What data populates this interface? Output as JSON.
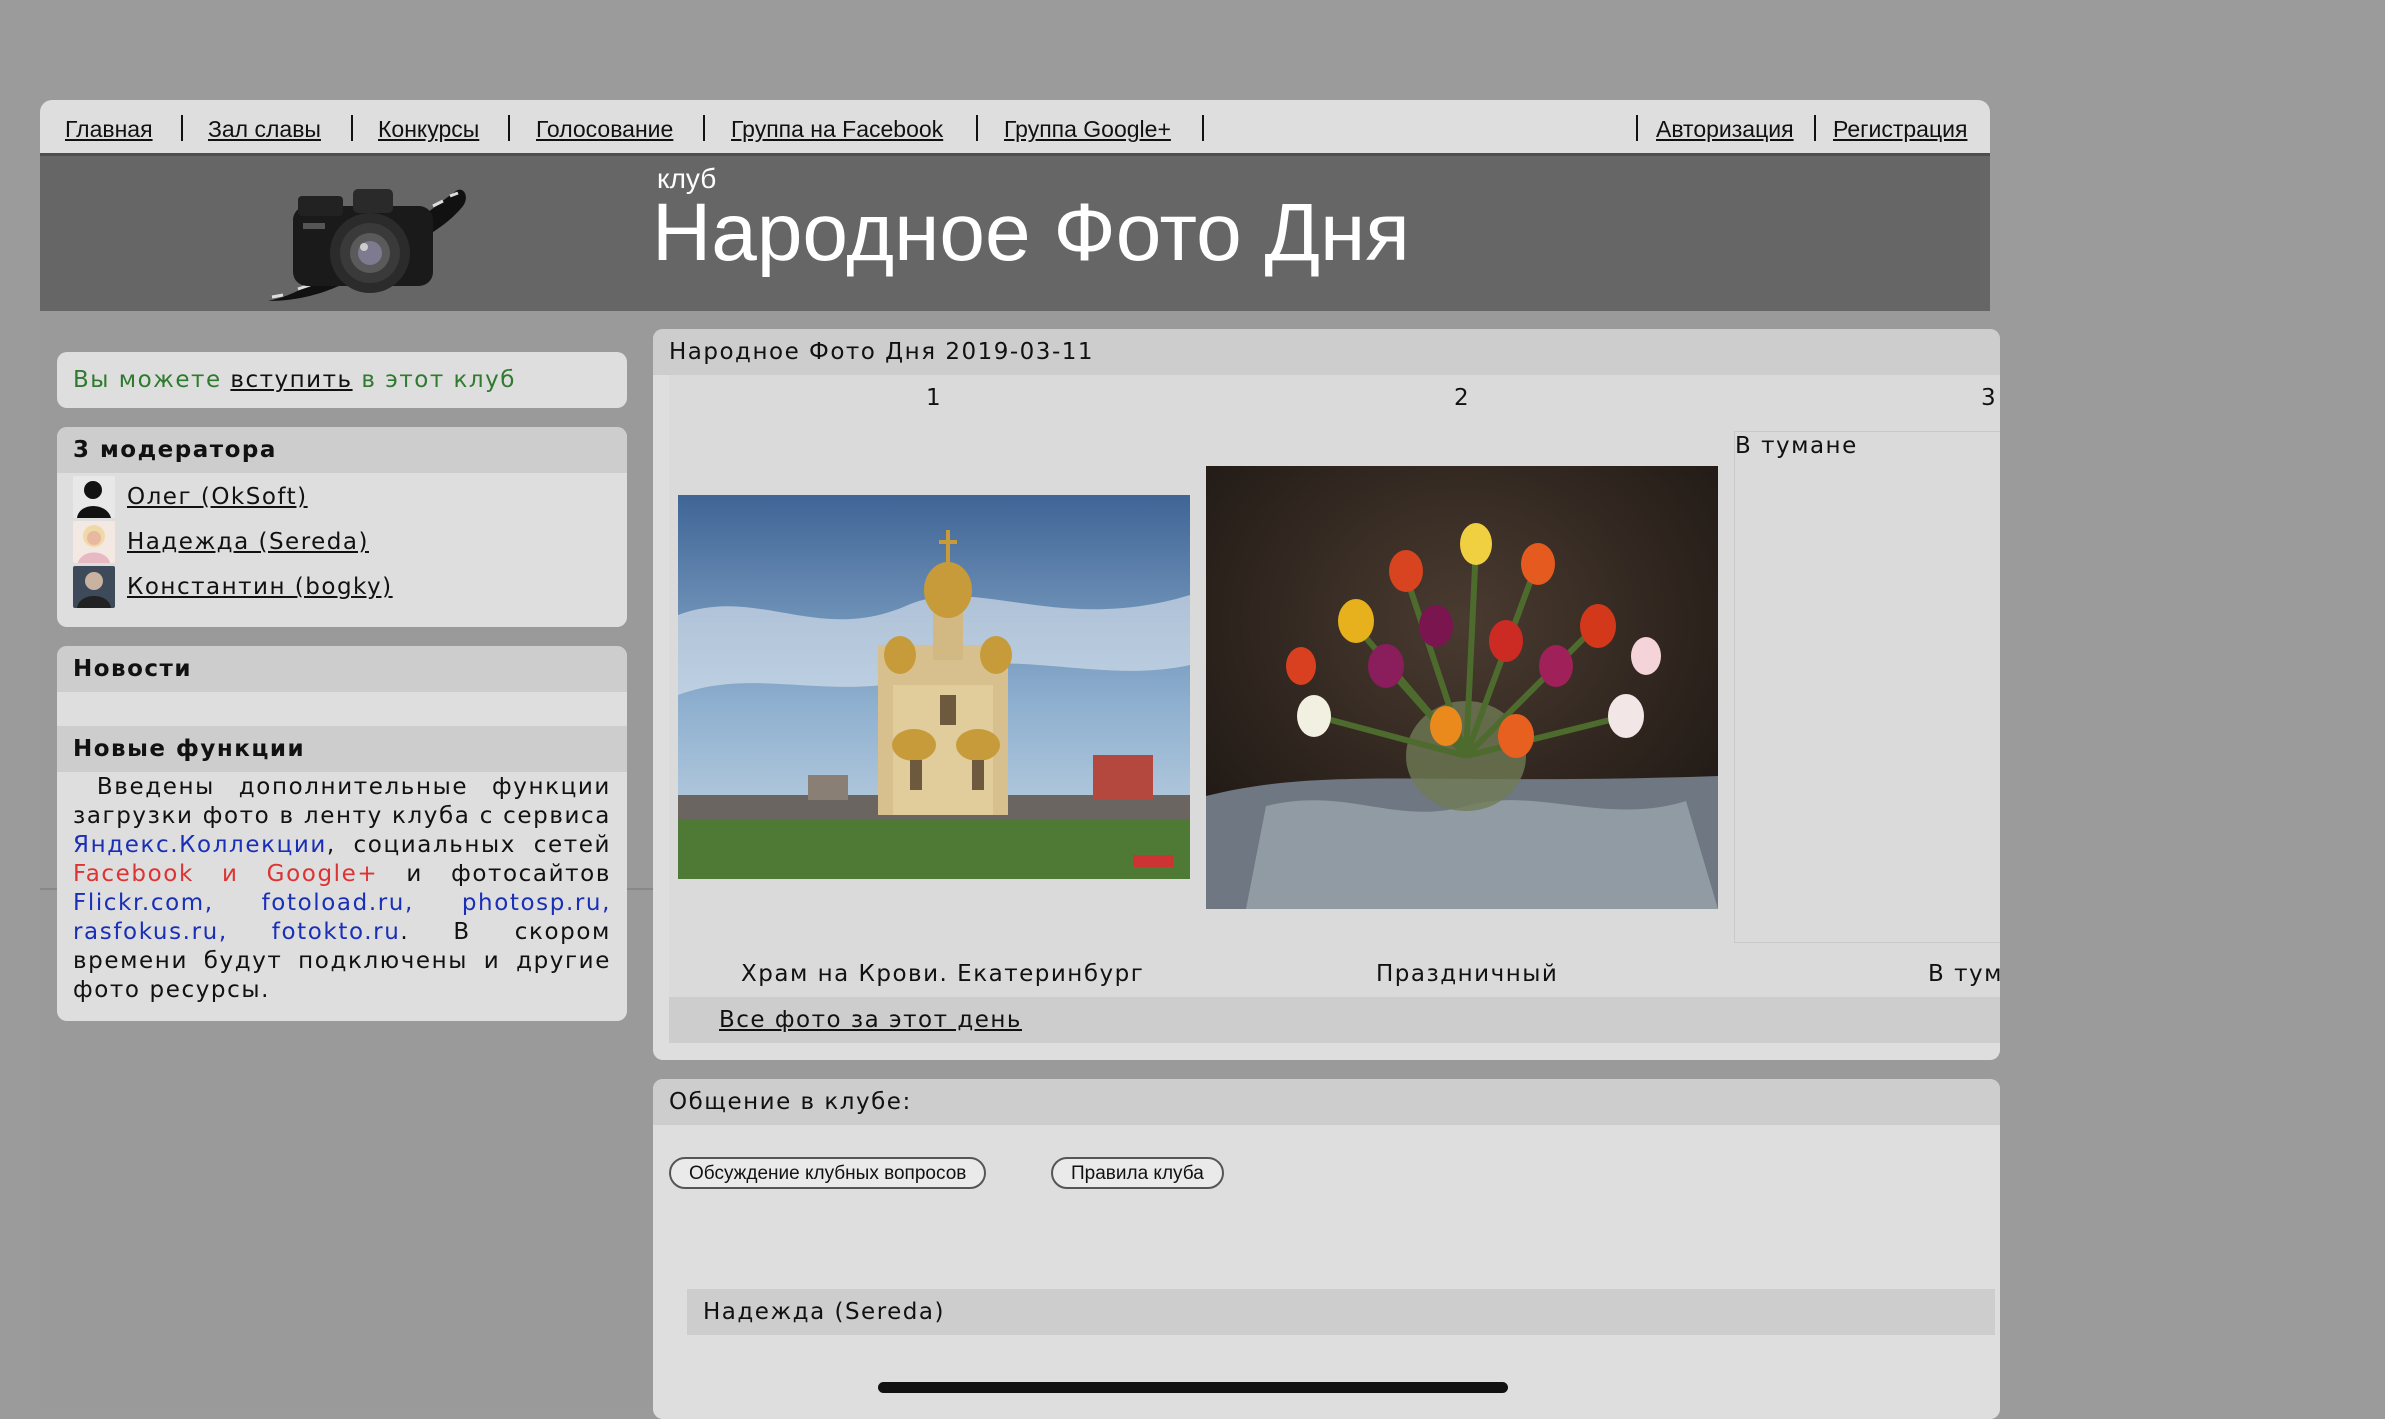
{
  "nav": {
    "left": [
      "Главная",
      "Зал славы",
      "Конкурсы",
      "Голосование",
      "Группа на Facebook",
      "Группа Google+"
    ],
    "right": [
      "Авторизация",
      "Регистрация"
    ]
  },
  "header": {
    "small": "клуб",
    "title": "Народное Фото Дня"
  },
  "join": {
    "before": "Вы можете ",
    "link": "вступить",
    "after": " в этот клуб"
  },
  "moderators": {
    "title": "3 модератора",
    "items": [
      "Олег (OkSoft)",
      "Надежда (Sereda)",
      "Константин (bogky)"
    ]
  },
  "news": {
    "title": "Новости",
    "subtitle": "Новые функции",
    "t1": "Введены дополнительные функции загрузки фото в ленту клуба с сервиса ",
    "l1": "Яндекс.Коллекции",
    "t2": ", социальных сетей ",
    "l2": "Facebook и Google+",
    "t3": " и фотосайтов ",
    "l3": "Flickr.com, fotoload.ru, photosp.ru, rasfokus.ru, fotokto.ru",
    "t4": ". В скором времени будут подключены и другие фото ресурсы."
  },
  "photoday": {
    "title": "Народное Фото Дня 2019-03-11",
    "numbers": [
      "1",
      "2",
      "3"
    ],
    "captions": [
      "Храм на Крови. Екатеринбург",
      "Праздничный",
      "В тумане"
    ],
    "placeholder_title": "В тумане",
    "all_link": "Все фото за этот день"
  },
  "chat": {
    "title": "Общение в клубе:",
    "buttons": [
      "Обсуждение клубных вопросов",
      "Правила клуба"
    ],
    "user": "Надежда (Sereda)"
  }
}
